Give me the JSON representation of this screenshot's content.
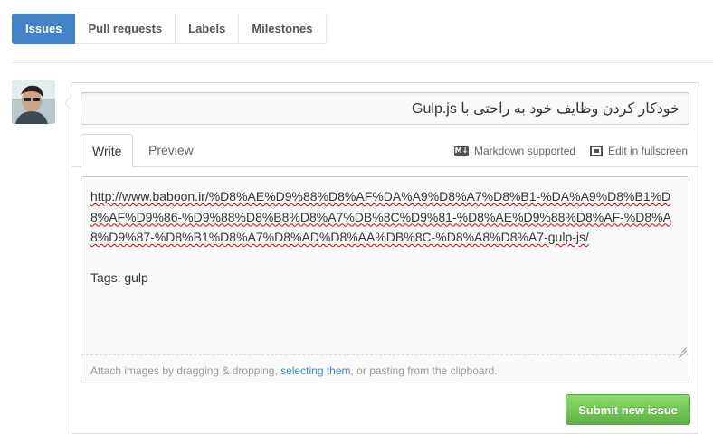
{
  "subnav": {
    "items": [
      {
        "label": "Issues",
        "selected": true
      },
      {
        "label": "Pull requests",
        "selected": false
      },
      {
        "label": "Labels",
        "selected": false
      },
      {
        "label": "Milestones",
        "selected": false
      }
    ]
  },
  "form": {
    "title_value": "خودکار کردن وظایف خود به راحتی با Gulp.js",
    "tabs": {
      "write": "Write",
      "preview": "Preview"
    },
    "toolbar": {
      "markdown": "Markdown supported",
      "fullscreen": "Edit in fullscreen"
    },
    "body": {
      "url": "http://www.baboon.ir/%D8%AE%D9%88%D8%AF%DA%A9%D8%A7%D8%B1-%DA%A9%D8%B1%D8%AF%D9%86-%D9%88%D8%B8%D8%A7%DB%8C%D9%81-%D8%AE%D9%88%D8%AF-%D8%A8%D9%87-%D8%B1%D8%A7%D8%AD%D8%AA%DB%8C-%D8%A8%D8%A7-gulp-js/",
      "tags": "Tags: gulp"
    },
    "attach": {
      "prefix": "Attach images by dragging & dropping, ",
      "link": "selecting them",
      "suffix": ", or pasting from the clipboard."
    },
    "submit_label": "Submit new issue"
  },
  "colors": {
    "accent": "#4183c4",
    "submit": "#6cc644"
  },
  "icons": {
    "markdown": "markdown-icon",
    "fullscreen": "fullscreen-icon",
    "avatar": "user-avatar"
  }
}
